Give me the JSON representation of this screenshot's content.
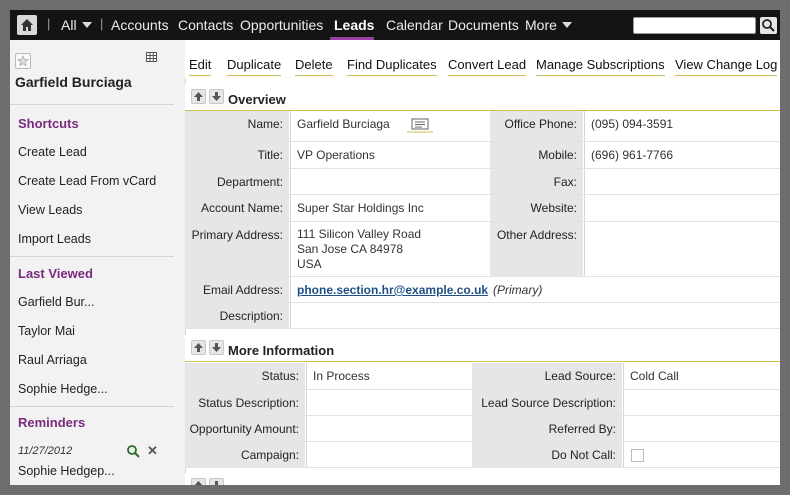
{
  "nav": {
    "all_label": "All",
    "items": [
      "Accounts",
      "Contacts",
      "Opportunities",
      "Leads",
      "Calendar",
      "Documents"
    ],
    "more_label": "More",
    "active": "Leads"
  },
  "record": {
    "name": "Garfield Burciaga"
  },
  "sidebar": {
    "shortcuts_title": "Shortcuts",
    "shortcuts": [
      "Create Lead",
      "Create Lead From vCard",
      "View Leads",
      "Import Leads"
    ],
    "last_viewed_title": "Last Viewed",
    "last_viewed": [
      "Garfield Bur...",
      "Taylor Mai",
      "Raul Arriaga",
      "Sophie Hedge..."
    ],
    "reminders_title": "Reminders",
    "reminder": {
      "date": "11/27/2012",
      "name": "Sophie Hedgep..."
    }
  },
  "toolbar": {
    "buttons": [
      "Edit",
      "Duplicate",
      "Delete",
      "Find Duplicates",
      "Convert Lead",
      "Manage Subscriptions",
      "View Change Log"
    ]
  },
  "overview": {
    "title": "Overview",
    "name_label": "Name:",
    "name": "Garfield Burciaga",
    "office_phone_label": "Office Phone:",
    "office_phone": "(095) 094-3591",
    "title_label": "Title:",
    "title_value": "VP Operations",
    "mobile_label": "Mobile:",
    "mobile": "(696) 961-7766",
    "department_label": "Department:",
    "department": "",
    "fax_label": "Fax:",
    "fax": "",
    "account_label": "Account Name:",
    "account": "Super Star Holdings Inc",
    "website_label": "Website:",
    "website": "",
    "primary_address_label": "Primary Address:",
    "address_line1": "111 Silicon Valley Road",
    "address_line2": "San Jose CA  84978",
    "address_line3": "USA",
    "other_address_label": "Other Address:",
    "other_address": "",
    "email_label": "Email Address:",
    "email": "phone.section.hr@example.co.uk",
    "email_tag": "(Primary)",
    "description_label": "Description:",
    "description": ""
  },
  "more_info": {
    "title": "More Information",
    "status_label": "Status:",
    "status": "In Process",
    "lead_source_label": "Lead Source:",
    "lead_source": "Cold Call",
    "status_desc_label": "Status Description:",
    "status_desc": "",
    "lead_source_desc_label": "Lead Source Description:",
    "lead_source_desc": "",
    "opp_amount_label": "Opportunity Amount:",
    "opp_amount": "",
    "referred_label": "Referred By:",
    "referred": "",
    "campaign_label": "Campaign:",
    "campaign": "",
    "dnc_label": "Do Not Call:"
  },
  "colors": {
    "accent": "#7a2a7f",
    "nav_bg": "#141414",
    "underline": "#c8bf56"
  }
}
